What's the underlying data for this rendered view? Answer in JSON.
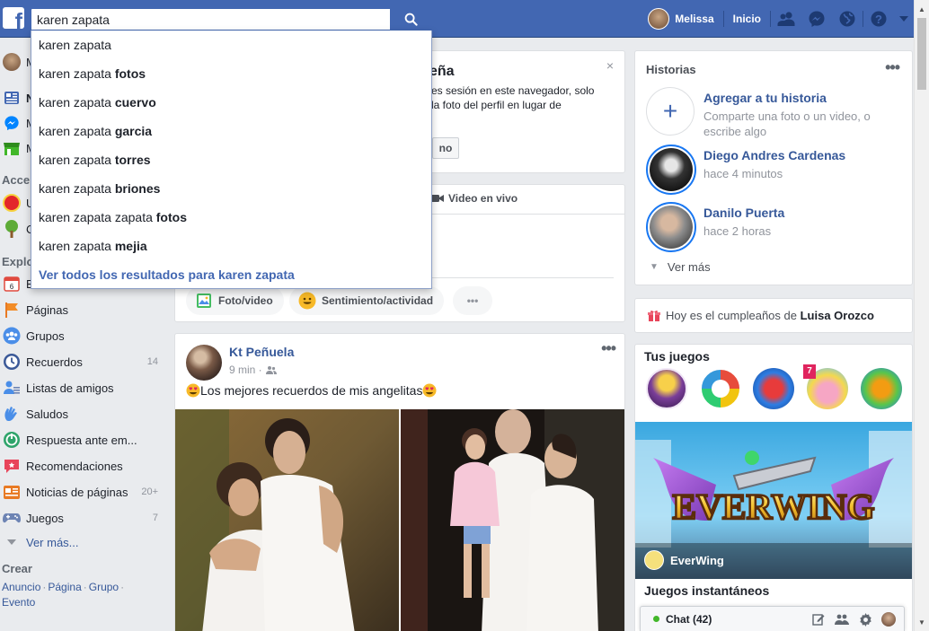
{
  "search": {
    "value": "karen zapata"
  },
  "autocomplete": {
    "items": [
      {
        "base": "karen zapata",
        "bold": ""
      },
      {
        "base": "karen zapata ",
        "bold": "fotos"
      },
      {
        "base": "karen zapata ",
        "bold": "cuervo"
      },
      {
        "base": "karen zapata ",
        "bold": "garcia"
      },
      {
        "base": "karen zapata ",
        "bold": "torres"
      },
      {
        "base": "karen zapata ",
        "bold": "briones"
      },
      {
        "base": "karen zapata zapata ",
        "bold": "fotos"
      },
      {
        "base": "karen zapata ",
        "bold": "mejia"
      }
    ],
    "see_all": "Ver todos los resultados para karen zapata"
  },
  "topnav": {
    "profile_name": "Melissa",
    "home": "Inicio"
  },
  "leftnav": {
    "partial": [
      {
        "label": "M"
      },
      {
        "label": "N"
      },
      {
        "label": "M"
      },
      {
        "label": "M"
      }
    ],
    "section_access": "Acce",
    "access_partial": [
      {
        "label": "U"
      },
      {
        "label": "C"
      }
    ],
    "section_explore": "Explo",
    "explore_partial": [
      {
        "label": "E"
      }
    ],
    "items": [
      {
        "label": "Páginas",
        "count": ""
      },
      {
        "label": "Grupos",
        "count": ""
      },
      {
        "label": "Recuerdos",
        "count": "14"
      },
      {
        "label": "Listas de amigos",
        "count": ""
      },
      {
        "label": "Saludos",
        "count": ""
      },
      {
        "label": "Respuesta ante em...",
        "count": ""
      },
      {
        "label": "Recomendaciones",
        "count": ""
      },
      {
        "label": "Noticias de páginas",
        "count": "20+"
      },
      {
        "label": "Juegos",
        "count": "7"
      }
    ],
    "see_more": "Ver más...",
    "section_create": "Crear",
    "create_links": [
      "Anuncio",
      "Página",
      "Grupo",
      "Evento"
    ]
  },
  "tip_card": {
    "title_partial": "eña",
    "text_partial": "es sesión en este navegador, solo la foto del perfil en lugar de",
    "button_partial": "no",
    "close": "×"
  },
  "composer": {
    "video_tab": "Video en vivo",
    "actions": [
      {
        "label": "Foto/video"
      },
      {
        "label": "Sentimiento/actividad"
      },
      {
        "label": "•••"
      }
    ]
  },
  "post": {
    "author": "Kt Peñuela",
    "time": "9 min ·",
    "text": "Los mejores recuerdos de mis angelitas",
    "dots": "•••"
  },
  "stories": {
    "title": "Historias",
    "dots": "•••",
    "add": {
      "name": "Agregar a tu historia",
      "sub": "Comparte una foto o un video, o escribe algo"
    },
    "items": [
      {
        "name": "Diego Andres Cardenas",
        "time": "hace 4 minutos"
      },
      {
        "name": "Danilo Puerta",
        "time": "hace 2 horas"
      }
    ],
    "see_more": "Ver más"
  },
  "birthday": {
    "prefix": "Hoy es el cumpleaños de ",
    "name": "Luisa Orozco"
  },
  "games": {
    "title": "Tus juegos",
    "badge": "7",
    "banner_title": "EVERWING",
    "banner_name": "EverWing",
    "instant_title": "Juegos instantáneos"
  },
  "chat": {
    "label": "Chat (42)"
  },
  "colors": {
    "brand": "#4267b2",
    "link": "#365899",
    "online": "#42b72a"
  }
}
